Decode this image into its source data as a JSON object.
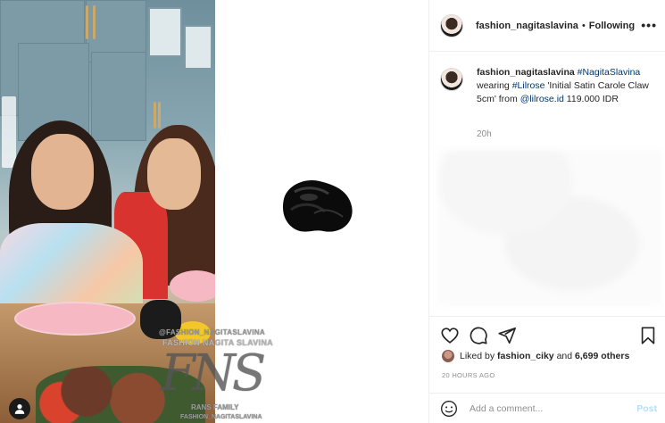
{
  "media": {
    "watermark": {
      "handle": "@FASHION_NAGITASLAVINA",
      "brand": "FASHION NAGITA SLAVINA",
      "logo": "FNS",
      "family": "RANS FAMILY",
      "bottom": "FASHION_NAGITASLAVINA"
    },
    "user_tag_icon": "person-icon",
    "product_image": "black-satin-claw-clip"
  },
  "header": {
    "username": "fashion_nagitaslavina",
    "separator": "•",
    "follow_state": "Following",
    "more_icon": "•••"
  },
  "caption": {
    "username": "fashion_nagitaslavina",
    "hashtag1": "#NagitaSlavina",
    "text1": "wearing",
    "hashtag2": "#Lilrose",
    "text2": "'Initial Satin Carole Claw 5cm' from",
    "mention": "@lilrose.id",
    "text3": "119.000 IDR",
    "time": "20h"
  },
  "actions": {
    "like_icon": "heart-icon",
    "comment_icon": "comment-icon",
    "share_icon": "share-icon",
    "save_icon": "bookmark-icon"
  },
  "likes": {
    "prefix": "Liked by",
    "user": "fashion_ciky",
    "and": "and",
    "others": "6,699 others"
  },
  "timestamp": "20 HOURS AGO",
  "comment": {
    "placeholder": "Add a comment...",
    "post_label": "Post"
  },
  "colors": {
    "link": "#00376b",
    "post_disabled": "#b2dffc",
    "muted": "#8e8e8e"
  }
}
